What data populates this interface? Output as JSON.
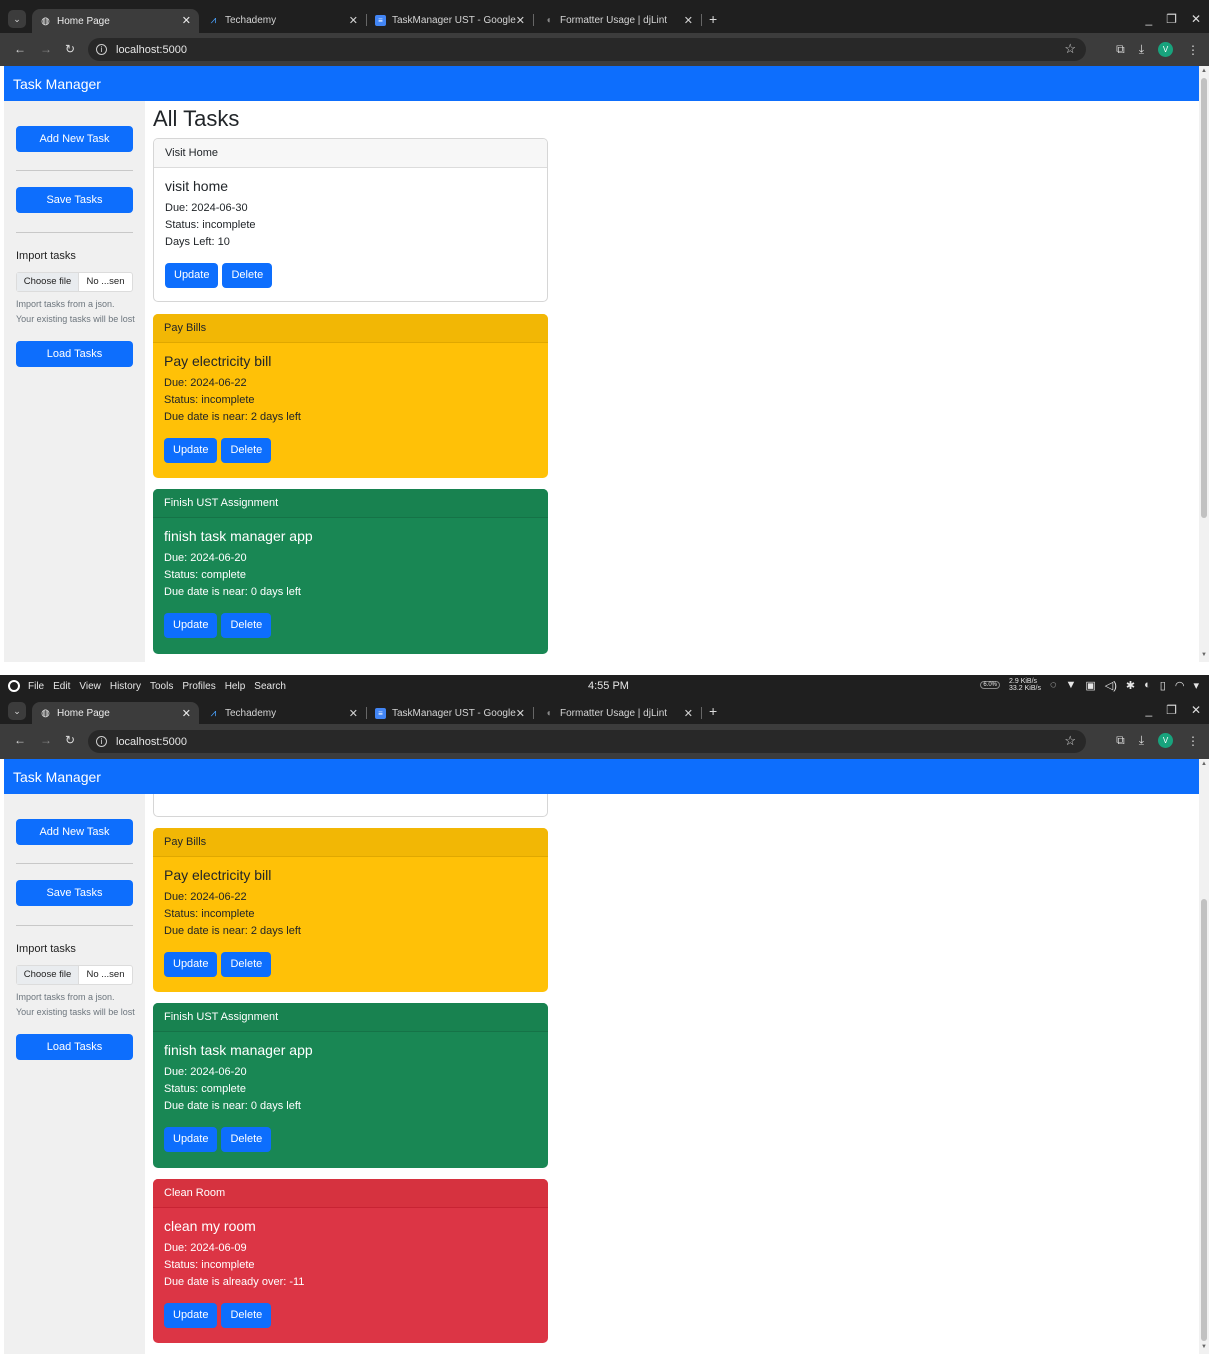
{
  "os_menubar": {
    "menus": [
      "File",
      "Edit",
      "View",
      "History",
      "Tools",
      "Profiles",
      "Help",
      "Search"
    ],
    "clock": "4:55 PM",
    "battery_pct": "6.0%",
    "net_down": "2.9 KiB/s",
    "net_up": "33.2 KiB/s"
  },
  "browser": {
    "tabs": [
      {
        "title": "Home Page",
        "icon": "globe-icon"
      },
      {
        "title": "Techademy",
        "icon": "techademy-icon"
      },
      {
        "title": "TaskManager UST - Google",
        "icon": "docs-icon"
      },
      {
        "title": "Formatter Usage | djLint",
        "icon": "djlint-icon"
      }
    ],
    "url": "localhost:5000",
    "profile_initial": "V"
  },
  "app": {
    "brand": "Task Manager",
    "heading": "All Tasks",
    "sidebar": {
      "add_label": "Add New Task",
      "save_label": "Save Tasks",
      "import_label": "Import tasks",
      "choose_label": "Choose file",
      "file_name": "No ...sen",
      "import_help": "Import tasks from a json. Your existing tasks will be lost",
      "load_label": "Load Tasks"
    },
    "update_label": "Update",
    "delete_label": "Delete",
    "tasks": [
      {
        "header": "Visit Home",
        "title": "visit home",
        "due": "Due: 2024-06-30",
        "status": "Status: incomplete",
        "note": "Days Left: 10",
        "style": "default"
      },
      {
        "header": "Pay Bills",
        "title": "Pay electricity bill",
        "due": "Due: 2024-06-22",
        "status": "Status: incomplete",
        "note": "Due date is near: 2 days left",
        "style": "warning"
      },
      {
        "header": "Finish UST Assignment",
        "title": "finish task manager app",
        "due": "Due: 2024-06-20",
        "status": "Status: complete",
        "note": "Due date is near: 0 days left",
        "style": "success"
      },
      {
        "header": "Clean Room",
        "title": "clean my room",
        "due": "Due: 2024-06-09",
        "status": "Status: incomplete",
        "note": "Due date is already over: -11",
        "style": "danger"
      }
    ]
  }
}
